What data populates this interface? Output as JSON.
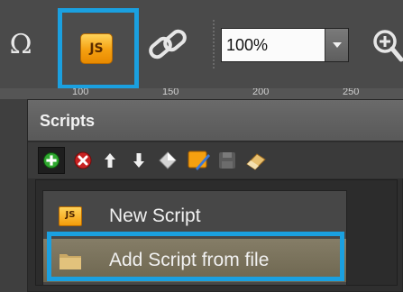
{
  "toolbar": {
    "omega_glyph": "Ω",
    "js_tool_label": "JS",
    "zoom_value": "100%"
  },
  "ruler": {
    "marks": [
      "100",
      "150",
      "200",
      "250"
    ]
  },
  "scripts_panel": {
    "title": "Scripts",
    "toolbar_icons": [
      "add-icon",
      "remove-icon",
      "arrow-up-icon",
      "arrow-down-icon",
      "diamond-icon",
      "js-edit-icon",
      "disk-icon",
      "eraser-icon"
    ]
  },
  "menu": {
    "items": [
      {
        "label": "New Script",
        "icon": "js-icon",
        "badge": "JS"
      },
      {
        "label": "Add Script from file",
        "icon": "folder-icon"
      }
    ]
  },
  "colors": {
    "highlight_frame": "#1aa0e0",
    "js_orange": "#f5a010"
  }
}
